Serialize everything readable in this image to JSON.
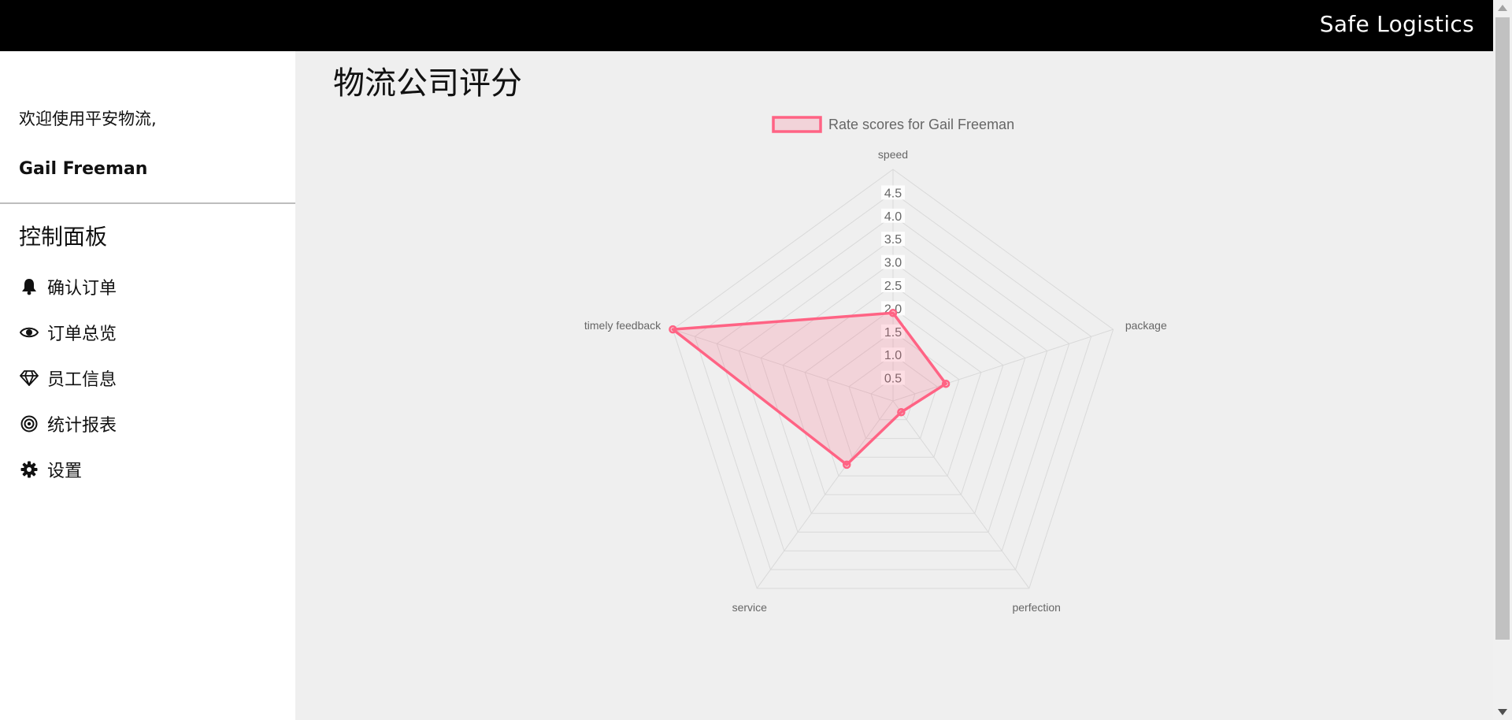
{
  "header": {
    "brand": "Safe Logistics"
  },
  "sidebar": {
    "welcome": "欢迎使用平安物流,",
    "username": "Gail Freeman",
    "panel_title": "控制面板",
    "items": [
      {
        "label": "确认订单",
        "icon": "bell-icon"
      },
      {
        "label": "订单总览",
        "icon": "eye-icon"
      },
      {
        "label": "员工信息",
        "icon": "diamond-icon"
      },
      {
        "label": "统计报表",
        "icon": "target-icon"
      },
      {
        "label": "设置",
        "icon": "gear-icon"
      }
    ]
  },
  "main": {
    "title": "物流公司评分"
  },
  "colors": {
    "series": "#ff6384",
    "series_fill": "rgba(255,99,132,0.2)",
    "grid": "#d9d9d9"
  },
  "chart_data": {
    "type": "radar",
    "legend": "Rate scores for Gail Freeman",
    "legend_position": "top",
    "categories": [
      "speed",
      "package",
      "perfection",
      "service",
      "timely feedback"
    ],
    "ticks": [
      "0.5",
      "1.0",
      "1.5",
      "2.0",
      "2.5",
      "3.0",
      "3.5",
      "4.0",
      "4.5"
    ],
    "rlim": [
      0,
      5
    ],
    "series": [
      {
        "name": "Rate scores for Gail Freeman",
        "values": [
          1.9,
          1.2,
          0.3,
          1.7,
          5.0
        ]
      }
    ]
  }
}
